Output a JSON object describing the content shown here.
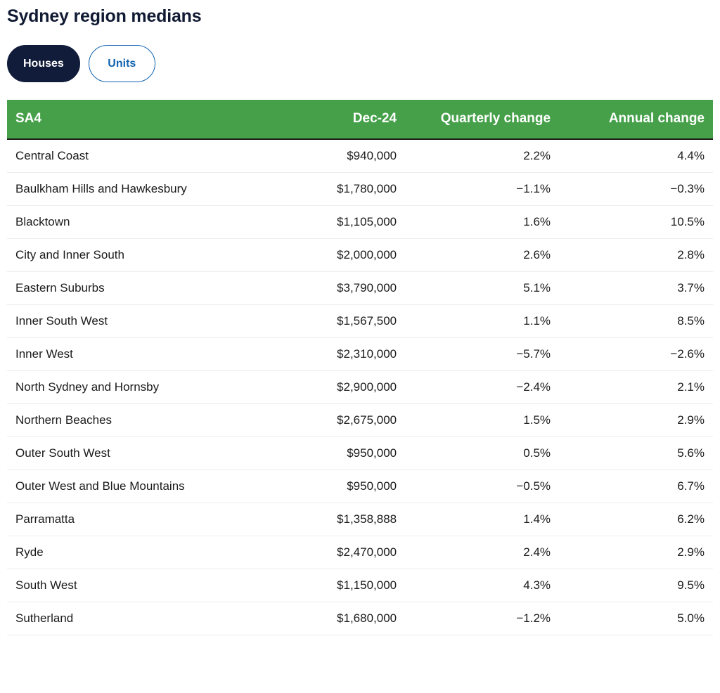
{
  "header": {
    "title": "Sydney region medians"
  },
  "toggle": {
    "options": [
      {
        "label": "Houses",
        "selected": true
      },
      {
        "label": "Units",
        "selected": false
      }
    ]
  },
  "colors": {
    "table_header_green": "#45a049",
    "pill_active_navy": "#111c3a",
    "pill_inactive_blue": "#1263b0",
    "title_navy": "#101a33",
    "row_divider": "#eceded"
  },
  "table": {
    "columns": [
      "SA4",
      "Dec-24",
      "Quarterly change",
      "Annual change"
    ],
    "rows": [
      {
        "sa4": "Central Coast",
        "median": "$940,000",
        "quarterly": "2.2%",
        "annual": "4.4%"
      },
      {
        "sa4": "Baulkham Hills and Hawkesbury",
        "median": "$1,780,000",
        "quarterly": "−1.1%",
        "annual": "−0.3%"
      },
      {
        "sa4": "Blacktown",
        "median": "$1,105,000",
        "quarterly": "1.6%",
        "annual": "10.5%"
      },
      {
        "sa4": "City and Inner South",
        "median": "$2,000,000",
        "quarterly": "2.6%",
        "annual": "2.8%"
      },
      {
        "sa4": "Eastern Suburbs",
        "median": "$3,790,000",
        "quarterly": "5.1%",
        "annual": "3.7%"
      },
      {
        "sa4": "Inner South West",
        "median": "$1,567,500",
        "quarterly": "1.1%",
        "annual": "8.5%"
      },
      {
        "sa4": "Inner West",
        "median": "$2,310,000",
        "quarterly": "−5.7%",
        "annual": "−2.6%"
      },
      {
        "sa4": "North Sydney and Hornsby",
        "median": "$2,900,000",
        "quarterly": "−2.4%",
        "annual": "2.1%"
      },
      {
        "sa4": "Northern Beaches",
        "median": "$2,675,000",
        "quarterly": "1.5%",
        "annual": "2.9%"
      },
      {
        "sa4": "Outer South West",
        "median": "$950,000",
        "quarterly": "0.5%",
        "annual": "5.6%"
      },
      {
        "sa4": "Outer West and Blue Mountains",
        "median": "$950,000",
        "quarterly": "−0.5%",
        "annual": "6.7%"
      },
      {
        "sa4": "Parramatta",
        "median": "$1,358,888",
        "quarterly": "1.4%",
        "annual": "6.2%"
      },
      {
        "sa4": "Ryde",
        "median": "$2,470,000",
        "quarterly": "2.4%",
        "annual": "2.9%"
      },
      {
        "sa4": "South West",
        "median": "$1,150,000",
        "quarterly": "4.3%",
        "annual": "9.5%"
      },
      {
        "sa4": "Sutherland",
        "median": "$1,680,000",
        "quarterly": "−1.2%",
        "annual": "5.0%"
      }
    ]
  },
  "chart_data": {
    "type": "table",
    "title": "Sydney region medians",
    "columns": [
      "SA4",
      "Dec-24",
      "Quarterly change",
      "Annual change"
    ],
    "categories": [
      "Central Coast",
      "Baulkham Hills and Hawkesbury",
      "Blacktown",
      "City and Inner South",
      "Eastern Suburbs",
      "Inner South West",
      "Inner West",
      "North Sydney and Hornsby",
      "Northern Beaches",
      "Outer South West",
      "Outer West and Blue Mountains",
      "Parramatta",
      "Ryde",
      "South West",
      "Sutherland"
    ],
    "series": [
      {
        "name": "Dec-24",
        "values": [
          940000,
          1780000,
          1105000,
          2000000,
          3790000,
          1567500,
          2310000,
          2900000,
          2675000,
          950000,
          950000,
          1358888,
          2470000,
          1150000,
          1680000
        ]
      },
      {
        "name": "Quarterly change",
        "values": [
          2.2,
          -1.1,
          1.6,
          2.6,
          5.1,
          1.1,
          -5.7,
          -2.4,
          1.5,
          0.5,
          -0.5,
          1.4,
          2.4,
          4.3,
          -1.2
        ]
      },
      {
        "name": "Annual change",
        "values": [
          4.4,
          -0.3,
          10.5,
          2.8,
          3.7,
          8.5,
          -2.6,
          2.1,
          2.9,
          5.6,
          6.7,
          6.2,
          2.9,
          9.5,
          5.0
        ]
      }
    ]
  }
}
